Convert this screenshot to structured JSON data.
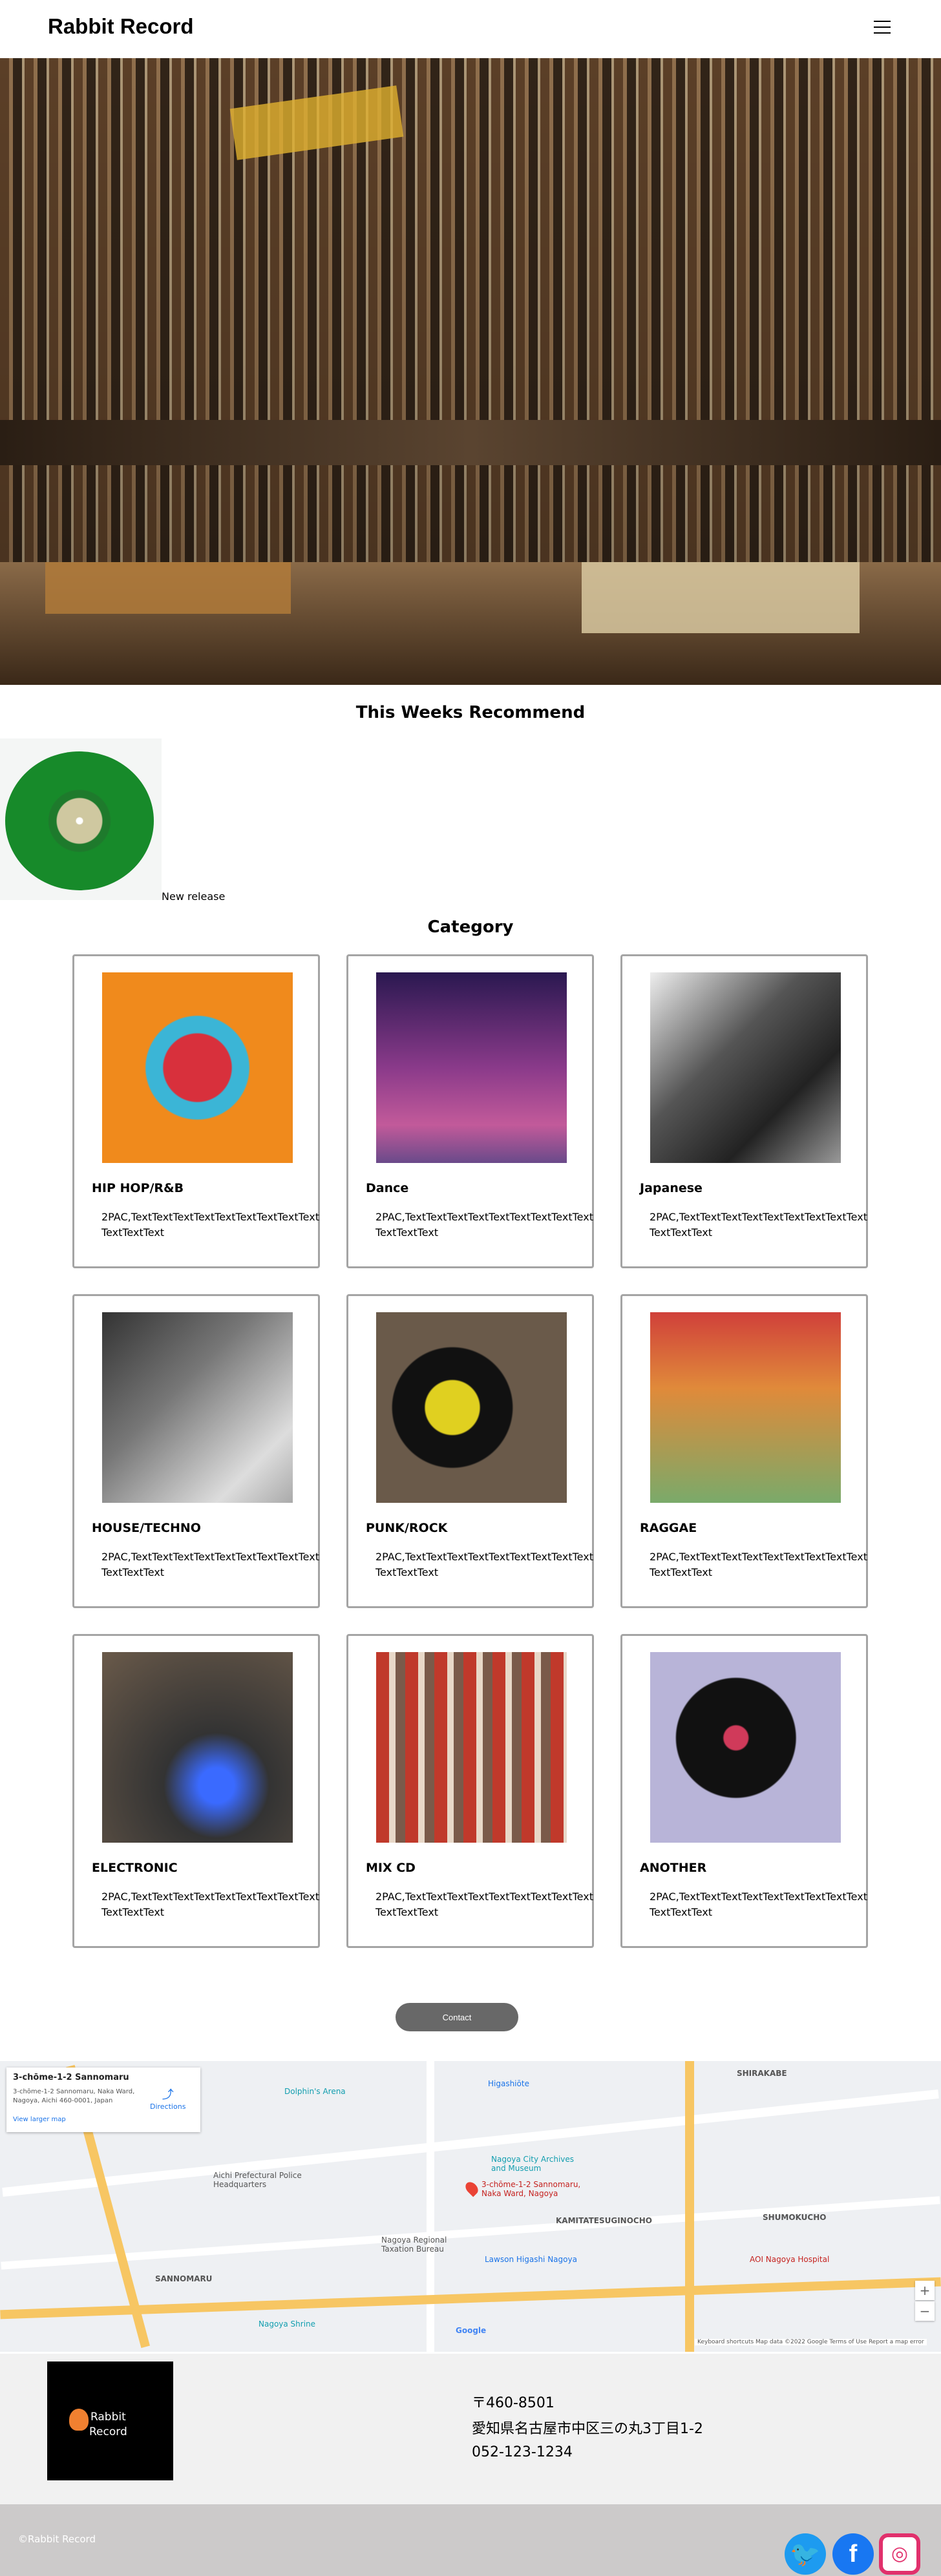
{
  "header": {
    "logo": "Rabbit Record",
    "menu_icon": "hamburger-icon"
  },
  "recommend": {
    "title": "This Weeks Recommend",
    "caption": "New release"
  },
  "category": {
    "title": "Category",
    "cards": [
      {
        "title": "HIP HOP/R&B",
        "desc": "2PAC,TextTextTextTextTextTextTextTextTextTextTextText"
      },
      {
        "title": "Dance",
        "desc": "2PAC,TextTextTextTextTextTextTextTextTextTextTextText"
      },
      {
        "title": "Japanese",
        "desc": "2PAC,TextTextTextTextTextTextTextTextTextTextTextText"
      },
      {
        "title": "HOUSE/TECHNO",
        "desc": "2PAC,TextTextTextTextTextTextTextTextTextTextTextText"
      },
      {
        "title": "PUNK/ROCK",
        "desc": "2PAC,TextTextTextTextTextTextTextTextTextTextTextText"
      },
      {
        "title": "RAGGAE",
        "desc": "2PAC,TextTextTextTextTextTextTextTextTextTextTextText"
      },
      {
        "title": "ELECTRONIC",
        "desc": "2PAC,TextTextTextTextTextTextTextTextTextTextTextText"
      },
      {
        "title": "MIX CD",
        "desc": "2PAC,TextTextTextTextTextTextTextTextTextTextTextText"
      },
      {
        "title": "ANOTHER",
        "desc": "2PAC,TextTextTextTextTextTextTextTextTextTextTextText"
      }
    ]
  },
  "contact": {
    "label": "Contact"
  },
  "map": {
    "place_title": "3-chōme-1-2 Sannomaru",
    "place_address": "3-chōme-1-2 Sannomaru, Naka Ward, Nagoya, Aichi 460-0001, Japan",
    "directions": "Directions",
    "view_larger": "View larger map",
    "labels": [
      "SHIRAKABE",
      "Higashiōte",
      "Dolphin's Arena",
      "Nagoya City Archives and Museum",
      "Aichi Prefectural Police Headquarters",
      "SANNOMARU",
      "3-chōme-1-2 Sannomaru, Naka Ward, Nagoya",
      "KAMITATESUGINOCHO",
      "SHUMOKUCHO",
      "Nagoya Regional Taxation Bureau",
      "Lawson Higashi Nagoya",
      "Nagoya Shrine",
      "AOI Nagoya Hospital",
      "Google"
    ],
    "footer": "Keyboard shortcuts   Map data ©2022 Google   Terms of Use   Report a map error"
  },
  "footer": {
    "logo": "Rabbit Record",
    "postal": "〒460-8501",
    "address": "愛知県名古屋市中区三の丸3丁目1-2",
    "phone": "052-123-1234",
    "copyright": "©Rabbit Record"
  },
  "social": [
    {
      "name": "twitter",
      "color": "#1d9bf0"
    },
    {
      "name": "facebook",
      "color": "#1877f2"
    },
    {
      "name": "instagram",
      "color": "#e1306c"
    }
  ]
}
